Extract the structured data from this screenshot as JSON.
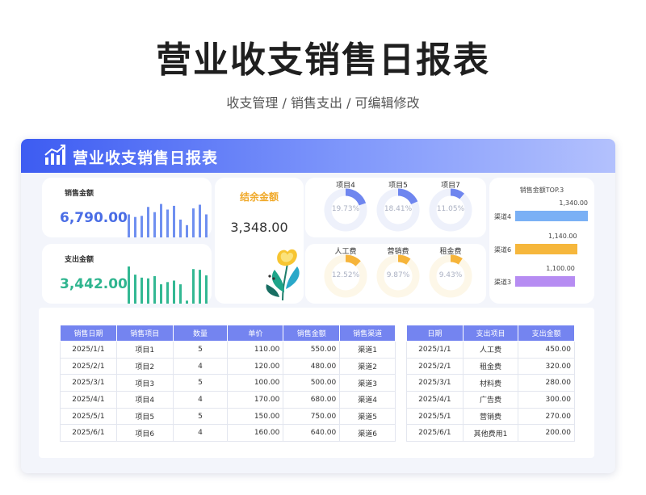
{
  "header": {
    "title": "营业收支销售日报表",
    "subtitle": "收支管理 / 销售支出 /  可编辑修改"
  },
  "sheet": {
    "banner_title": "营业收支销售日报表"
  },
  "sales_card": {
    "label": "销售金额",
    "value": "6,790.00",
    "color": "#4a6de5",
    "bars": [
      0.62,
      0.55,
      0.58,
      0.82,
      0.68,
      0.9,
      0.75,
      0.85,
      0.48,
      0.33,
      0.78,
      0.88,
      0.62
    ]
  },
  "expense_card": {
    "label": "支出金额",
    "value": "3,442.00",
    "color": "#2fb58f",
    "bars": [
      1.0,
      0.78,
      0.7,
      0.68,
      0.74,
      0.52,
      0.58,
      0.62,
      0.52,
      0.08,
      0.93,
      0.91,
      0.76
    ]
  },
  "balance_card": {
    "label": "结余金额",
    "value": "3,348.00"
  },
  "sales_donuts": [
    {
      "label": "项目4",
      "pct": "19.73%",
      "fraction": 0.1973
    },
    {
      "label": "项目5",
      "pct": "18.41%",
      "fraction": 0.1841
    },
    {
      "label": "项目7",
      "pct": "11.05%",
      "fraction": 0.1105
    }
  ],
  "expense_donuts": [
    {
      "label": "人工费",
      "pct": "12.52%",
      "fraction": 0.1252
    },
    {
      "label": "营销费",
      "pct": "9.87%",
      "fraction": 0.0987
    },
    {
      "label": "租金费",
      "pct": "9.43%",
      "fraction": 0.0943
    }
  ],
  "top3": {
    "title": "销售金额TOP.3",
    "items": [
      {
        "name": "渠道4",
        "value": "1,340.00",
        "amount": 1340,
        "color": "#7ab0f5"
      },
      {
        "name": "渠道6",
        "value": "1,140.00",
        "amount": 1140,
        "color": "#f6b73c"
      },
      {
        "name": "渠道3",
        "value": "1,100.00",
        "amount": 1100,
        "color": "#b68cf2"
      }
    ]
  },
  "sales_table": {
    "headers": [
      "销售日期",
      "销售项目",
      "数量",
      "单价",
      "销售金额",
      "销售渠道"
    ],
    "rows": [
      [
        "2025/1/1",
        "项目1",
        "5",
        "110.00",
        "550.00",
        "渠道1"
      ],
      [
        "2025/2/1",
        "项目2",
        "4",
        "120.00",
        "480.00",
        "渠道2"
      ],
      [
        "2025/3/1",
        "项目3",
        "5",
        "100.00",
        "500.00",
        "渠道3"
      ],
      [
        "2025/4/1",
        "项目4",
        "4",
        "170.00",
        "680.00",
        "渠道4"
      ],
      [
        "2025/5/1",
        "项目5",
        "5",
        "150.00",
        "750.00",
        "渠道5"
      ],
      [
        "2025/6/1",
        "项目6",
        "4",
        "160.00",
        "640.00",
        "渠道6"
      ]
    ]
  },
  "expense_table": {
    "headers": [
      "日期",
      "支出项目",
      "支出金额"
    ],
    "rows": [
      [
        "2025/1/1",
        "人工费",
        "450.00"
      ],
      [
        "2025/2/1",
        "租金费",
        "320.00"
      ],
      [
        "2025/3/1",
        "材料费",
        "280.00"
      ],
      [
        "2025/4/1",
        "广告费",
        "300.00"
      ],
      [
        "2025/5/1",
        "营销费",
        "270.00"
      ],
      [
        "2025/6/1",
        "其他费用1",
        "200.00"
      ]
    ]
  },
  "colors": {
    "accent": "#3d5cf2",
    "sales_donut": "#6f86ef",
    "expense_donut": "#f6b43a",
    "table_header": "#7484f0",
    "balance_label": "#f0a92a"
  }
}
